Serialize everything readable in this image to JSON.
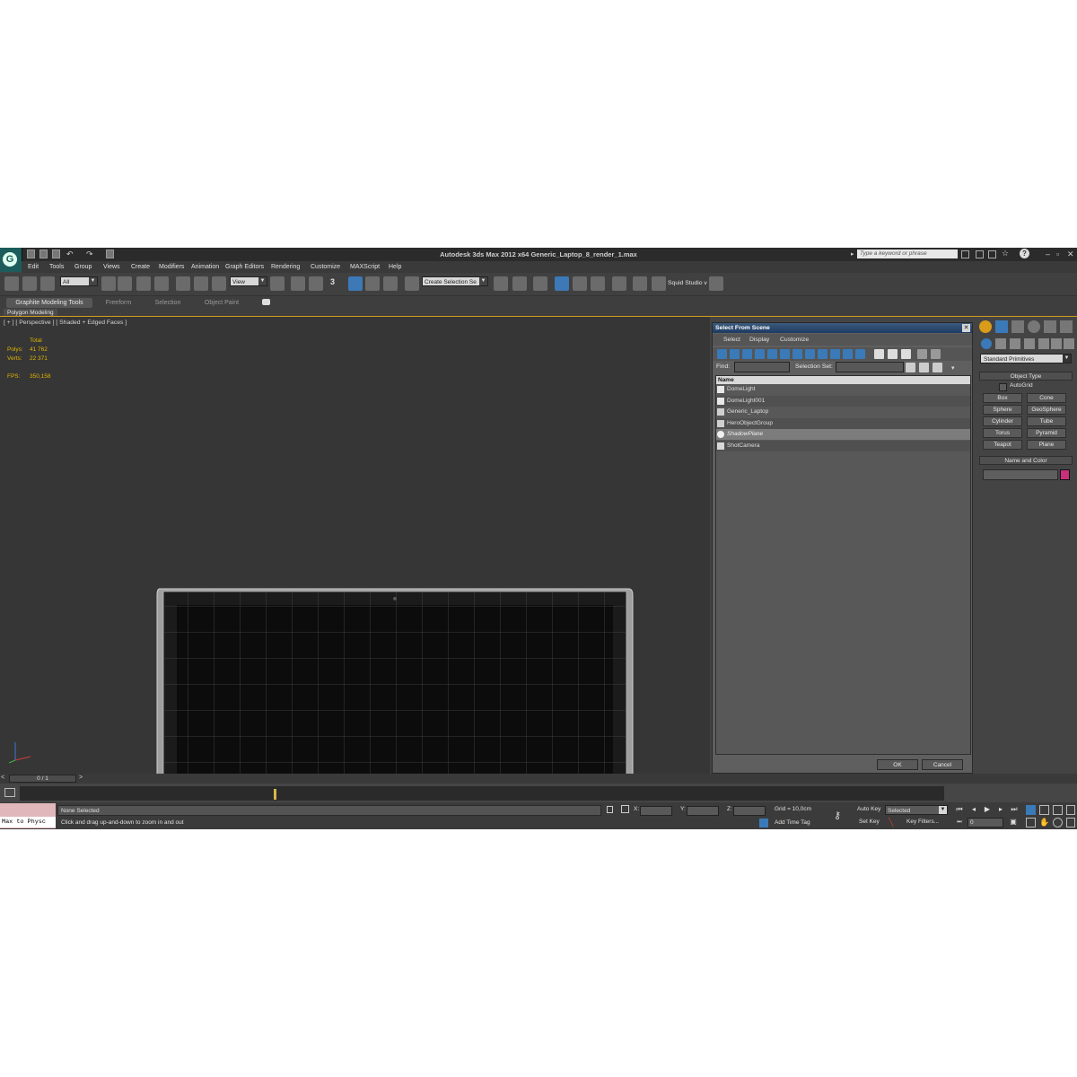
{
  "app": {
    "title": "Autodesk 3ds Max  2012 x64     Generic_Laptop_8_render_1.max",
    "search_placeholder": "Type a keyword or phrase",
    "logo_letter": "G"
  },
  "menu": [
    "Edit",
    "Tools",
    "Group",
    "Views",
    "Create",
    "Modifiers",
    "Animation",
    "Graph Editors",
    "Rendering",
    "Customize",
    "MAXScript",
    "Help"
  ],
  "toolbar": {
    "filter_value": "All",
    "refcoord_value": "View",
    "snap_label": "3",
    "named_selection_value": "Create Selection Se",
    "renderer_label": "Squid Studio v"
  },
  "ribbon": {
    "tabs": [
      "Graphite Modeling Tools",
      "Freeform",
      "Selection",
      "Object Paint"
    ],
    "active_tab": "Graphite Modeling Tools",
    "subtab": "Polygon Modeling"
  },
  "viewport": {
    "label": "[ + ] [ Perspective ] [ Shaded + Edged Faces ]",
    "stats": {
      "header": "Total",
      "polys_label": "Polys:",
      "polys_value": "41 762",
      "verts_label": "Verts:",
      "verts_value": "22 371",
      "fps_label": "FPS:",
      "fps_value": "350,158"
    }
  },
  "dialog": {
    "title": "Select From Scene",
    "menu": [
      "Select",
      "Display",
      "Customize"
    ],
    "find_label": "Find:",
    "find_value": "",
    "selection_set_label": "Selection Set:",
    "column_header": "Name",
    "objects": [
      {
        "name": "DomeLight",
        "icon": "light-icon",
        "selected": false
      },
      {
        "name": "DomeLight001",
        "icon": "light-icon",
        "selected": false
      },
      {
        "name": "Generic_Laptop",
        "icon": "group-icon",
        "selected": false
      },
      {
        "name": "HeroObjectGroup",
        "icon": "group-icon",
        "selected": false
      },
      {
        "name": "ShadowPlane",
        "icon": "geometry-icon",
        "selected": true
      },
      {
        "name": "ShotCamera",
        "icon": "camera-icon",
        "selected": false
      }
    ],
    "ok_label": "OK",
    "cancel_label": "Cancel"
  },
  "command_panel": {
    "category": "Standard Primitives",
    "object_type_title": "Object Type",
    "autogrid_label": "AutoGrid",
    "buttons": [
      "Box",
      "Cone",
      "Sphere",
      "GeoSphere",
      "Cylinder",
      "Tube",
      "Torus",
      "Pyramid",
      "Teapot",
      "Plane"
    ],
    "name_color_title": "Name and Color",
    "object_color": "#c8307a"
  },
  "timeline": {
    "frame_label": "0 / 1"
  },
  "status": {
    "maxscript_text": "Max to Physc",
    "selection_status": "None Selected",
    "prompt": "Click and drag up-and-down to zoom in and out",
    "x_label": "X:",
    "y_label": "Y:",
    "z_label": "Z:",
    "grid": "Grid = 10,0cm",
    "add_time_tag": "Add Time Tag",
    "auto_key": "Auto Key",
    "set_key": "Set Key",
    "key_mode_value": "Selected",
    "key_filters": "Key Filters...",
    "current_frame": "0"
  },
  "colors": {
    "accent": "#d49a20",
    "dialog_title": "#1e3b63",
    "viewport_bg": "#363636"
  }
}
